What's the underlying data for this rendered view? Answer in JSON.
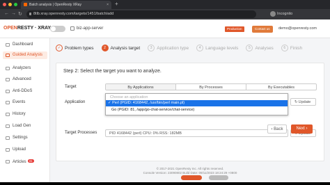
{
  "browser": {
    "tab_title": "Batch analysis | OpenResty XRay",
    "tab_close": "×",
    "new_tab": "+",
    "url": "8tlb.xray.openresty.com/targets/1451/batch/add",
    "incognito": "Incognito"
  },
  "header": {
    "logo_open": "OPEN",
    "logo_rest": "RESTY · XRAY",
    "server": "biz-app-server",
    "production_badge": "Production",
    "contact": "Contact us",
    "user": "demo@openresty.com"
  },
  "sidebar": {
    "items": [
      {
        "label": "Dashboard"
      },
      {
        "label": "Guided Analysis"
      },
      {
        "label": "Analyzers"
      },
      {
        "label": "Advanced"
      },
      {
        "label": "Anti-DDoS"
      },
      {
        "label": "Events"
      },
      {
        "label": "History"
      },
      {
        "label": "Load Gen"
      },
      {
        "label": "Settings"
      },
      {
        "label": "Upload"
      },
      {
        "label": "Articles",
        "badge": "31"
      }
    ]
  },
  "steps": [
    {
      "num": "✓",
      "label": "Problem types"
    },
    {
      "num": "2",
      "label": "Analysis target"
    },
    {
      "num": "3",
      "label": "Application type"
    },
    {
      "num": "4",
      "label": "Language levels"
    },
    {
      "num": "5",
      "label": "Analyses"
    },
    {
      "num": "6",
      "label": "Finish"
    }
  ],
  "panel": {
    "title": "Step 2: Select the target you want to analyze.",
    "target_label": "Target",
    "target_options": [
      "By Applications",
      "By Processes",
      "By Executables"
    ],
    "application_label": "Application",
    "dropdown_placeholder": "Choose an application",
    "dropdown_selected": "✓ Perl (PGID: 4168442, /usr/bin/perl main.pl)",
    "dropdown_option": "Go (PGID: 81, /app/go-chat-service/chat-service)",
    "update": "Update",
    "target_processes_label": "Target Processes",
    "target_processes_value": "PID 4168442 (perl) CPU: 0% RSS: 182MB",
    "back": "Back",
    "next": "Next"
  },
  "footer": {
    "line1": "© 2017-2021 OpenResty Inc. All rights reserved.",
    "line2": "Console Version: 23090802 Build Date: 09/11/2023 18:24:29 +0800"
  },
  "colors": {
    "accent": "#e0572a",
    "selection": "#1a73e8"
  }
}
